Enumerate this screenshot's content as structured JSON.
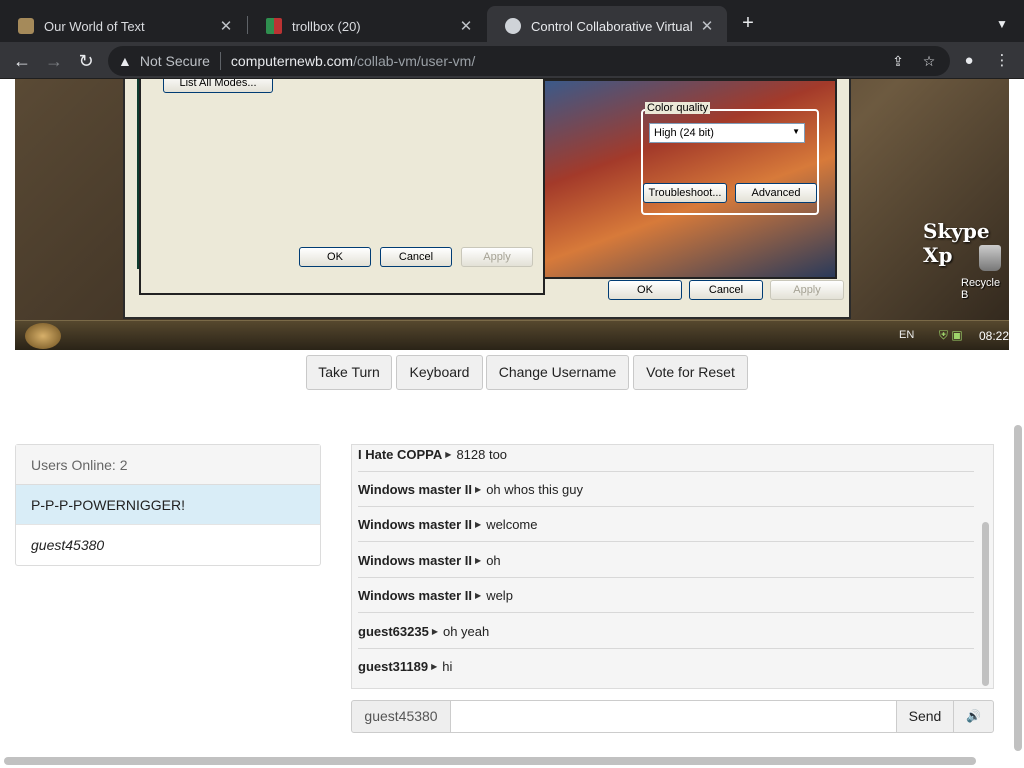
{
  "browser": {
    "tabs": [
      {
        "title": "Our World of Text",
        "close": "✕"
      },
      {
        "title": "trollbox (20)",
        "close": "✕"
      },
      {
        "title": "Control Collaborative Virtual M",
        "close": "✕"
      }
    ],
    "new_tab": "+",
    "security_label": "Not Secure",
    "url_host": "computernewb.com",
    "url_path": "/collab-vm/user-vm/"
  },
  "vm": {
    "list_modes_label": "List All Modes...",
    "inner_dialog": {
      "ok": "OK",
      "cancel": "Cancel",
      "apply": "Apply"
    },
    "outer_dialog": {
      "ok": "OK",
      "cancel": "Cancel",
      "apply": "Apply"
    },
    "color_quality": {
      "label": "Color quality",
      "value": "High (24 bit)",
      "troubleshoot": "Troubleshoot...",
      "advanced": "Advanced"
    },
    "desktop": {
      "skype_label": "Skype Xp",
      "recycle_label": "Recycle B"
    },
    "taskbar": {
      "lang": "EN",
      "clock": "08:22"
    }
  },
  "controls": {
    "take_turn": "Take Turn",
    "keyboard": "Keyboard",
    "change_username": "Change Username",
    "vote_reset": "Vote for Reset"
  },
  "users": {
    "header": "Users Online: 2",
    "list": [
      "P-P-P-POWERNIGGER!",
      "guest45380"
    ]
  },
  "chat": {
    "messages": [
      {
        "user": "I Hate COPPA",
        "text": "8128 too"
      },
      {
        "user": "Windows master II",
        "text": "oh whos this guy"
      },
      {
        "user": "Windows master II",
        "text": "welcome"
      },
      {
        "user": "Windows master II",
        "text": "oh"
      },
      {
        "user": "Windows master II",
        "text": "welp"
      },
      {
        "user": "guest63235",
        "text": "oh yeah"
      },
      {
        "user": "guest31189",
        "text": "hi"
      }
    ],
    "username": "guest45380",
    "input_value": "",
    "send": "Send"
  }
}
